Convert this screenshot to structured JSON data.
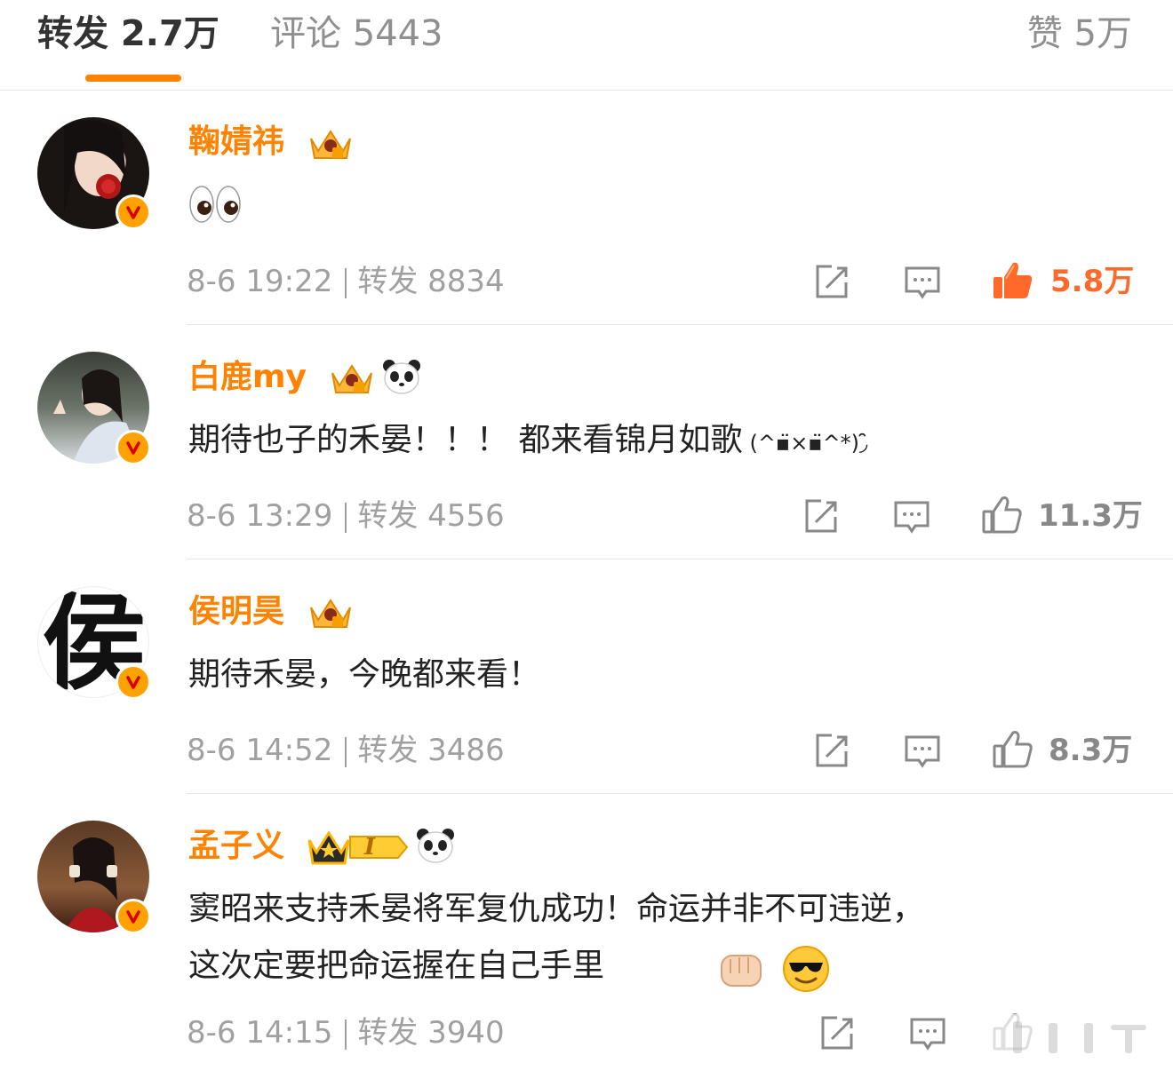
{
  "tabs": {
    "repost": "转发 2.7万",
    "comment": "评论 5443",
    "like": "赞 5万"
  },
  "colors": {
    "accent": "#ff8200",
    "username": "#ff8200",
    "text": "#222222",
    "meta": "#a0a0a0",
    "verified": "#ffa200"
  },
  "comments": [
    {
      "username": "鞠婧祎",
      "badges": [
        "crown-icon"
      ],
      "text": "",
      "emoji": [
        "eyes-icon"
      ],
      "time": "8-6 19:22",
      "repost_label": "转发 8834",
      "likes": "5.8万",
      "liked": true
    },
    {
      "username": "白鹿my",
      "badges": [
        "crown-icon",
        "panda-icon"
      ],
      "text": "期待也子的禾晏！！！ 都来看锦月如歌",
      "kaomoji": "(^▪̈×▪̈^*)◞̑̑",
      "time": "8-6 13:29",
      "repost_label": "转发 4556",
      "likes": "11.3万",
      "liked": false
    },
    {
      "username": "侯明昊",
      "badges": [
        "crown-icon"
      ],
      "avatar_char": "侯",
      "text": "期待禾晏，今晚都来看！",
      "time": "8-6 14:52",
      "repost_label": "转发 3486",
      "likes": "8.3万",
      "liked": false
    },
    {
      "username": "孟子义",
      "badges": [
        "crown-level-icon",
        "panda-icon"
      ],
      "crown_level": "I",
      "text_line1": "窦昭来支持禾晏将军复仇成功！命运并非不可违逆，",
      "text_line2": "这次定要把命运握在自己手里",
      "emoji": [
        "fist-icon",
        "sunglasses-face-icon"
      ],
      "time": "8-6 14:15",
      "repost_label": "转发 3940",
      "likes": "",
      "liked": false
    }
  ]
}
